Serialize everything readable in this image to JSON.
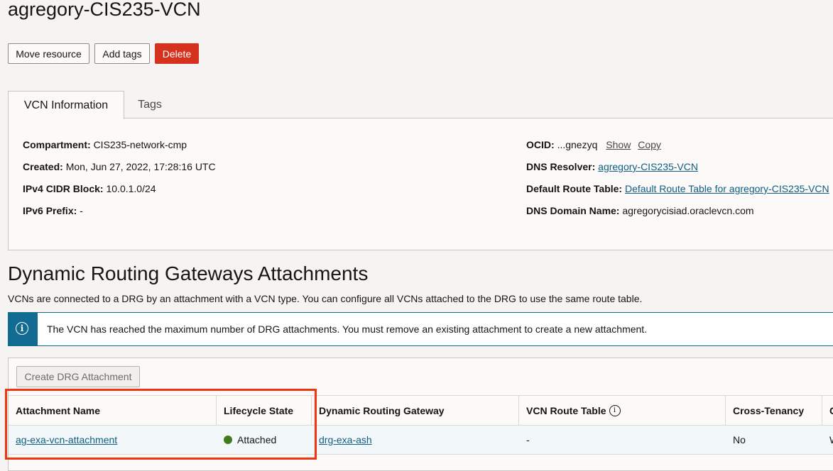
{
  "page": {
    "title": "agregory-CIS235-VCN"
  },
  "actions": {
    "move": "Move resource",
    "add_tags": "Add tags",
    "delete": "Delete"
  },
  "tabs": [
    {
      "label": "VCN Information",
      "active": true
    },
    {
      "label": "Tags",
      "active": false
    }
  ],
  "info": {
    "compartment_label": "Compartment:",
    "compartment_value": "CIS235-network-cmp",
    "created_label": "Created:",
    "created_value": "Mon, Jun 27, 2022, 17:28:16 UTC",
    "ipv4_label": "IPv4 CIDR Block:",
    "ipv4_value": "10.0.1.0/24",
    "ipv6_label": "IPv6 Prefix:",
    "ipv6_value": "-",
    "ocid_label": "OCID:",
    "ocid_value": "...gnezyq",
    "ocid_show": "Show",
    "ocid_copy": "Copy",
    "dns_resolver_label": "DNS Resolver:",
    "dns_resolver_value": "agregory-CIS235-VCN",
    "route_table_label": "Default Route Table:",
    "route_table_value": "Default Route Table for agregory-CIS235-VCN",
    "dns_domain_label": "DNS Domain Name:",
    "dns_domain_value": "agregorycisiad.oraclevcn.com"
  },
  "drg": {
    "title": "Dynamic Routing Gateways Attachments",
    "description": "VCNs are connected to a DRG by an attachment with a VCN type. You can configure all VCNs attached to the DRG to use the same route table.",
    "alert": "The VCN has reached the maximum number of DRG attachments. You must remove an existing attachment to create a new attachment.",
    "create_button": "Create DRG Attachment",
    "columns": [
      "Attachment Name",
      "Lifecycle State",
      "Dynamic Routing Gateway",
      "VCN Route Table",
      "Cross-Tenancy",
      "C"
    ],
    "rows": [
      {
        "name": "ag-exa-vcn-attachment",
        "state": "Attached",
        "gateway": "drg-exa-ash",
        "route_table": "-",
        "cross_tenancy": "No",
        "extra": "W"
      }
    ]
  },
  "colors": {
    "delete": "#d6311d",
    "link": "#0f5e82",
    "alert": "#126b92",
    "attached": "#3e7d1e",
    "highlight": "#f03511"
  }
}
